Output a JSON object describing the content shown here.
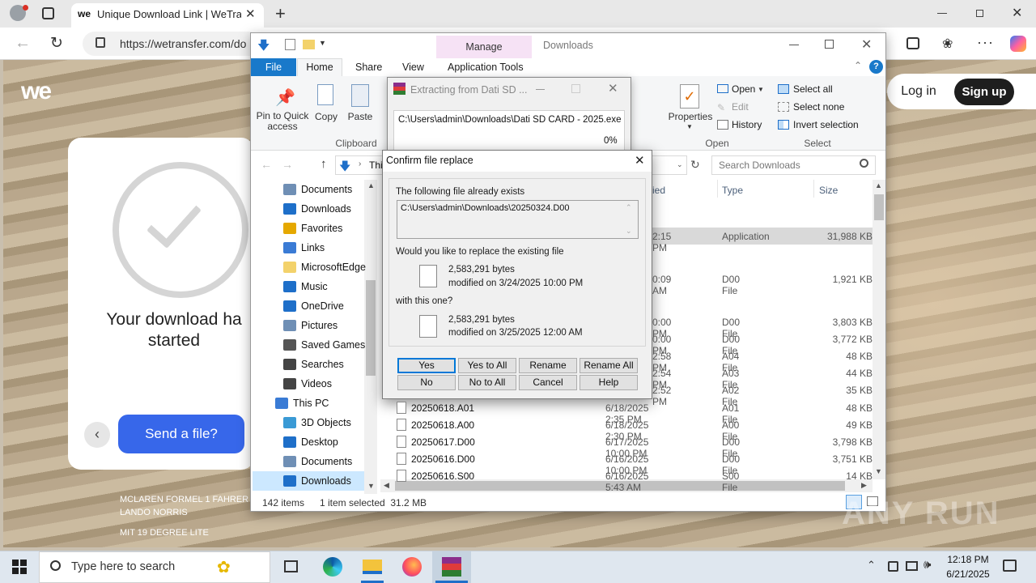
{
  "browser": {
    "tab_title": "Unique Download Link | WeTransf",
    "url": "https://wetransfer.com/do"
  },
  "wetransfer": {
    "logo": "we",
    "login": "Log in",
    "signup": "Sign up",
    "card_title": "Your download ha started",
    "send_button": "Send a file?",
    "caption_line1": "MCLAREN FORMEL 1 FAHRER",
    "caption_line2": "LANDO NORRIS",
    "caption_line3": "MIT 19 DEGREE LITE"
  },
  "explorer": {
    "manage_tab": "Manage",
    "window_title": "Downloads",
    "tabs": {
      "file": "File",
      "home": "Home",
      "share": "Share",
      "view": "View",
      "app_tools": "Application Tools"
    },
    "ribbon": {
      "pin": "Pin to Quick access",
      "copy": "Copy",
      "paste": "Paste",
      "clipboard": "Clipboard",
      "properties": "Properties",
      "open": "Open",
      "edit": "Edit",
      "history": "History",
      "open_group": "Open",
      "select_all": "Select all",
      "select_none": "Select none",
      "invert": "Invert selection",
      "select_group": "Select"
    },
    "path_partial": "Thi",
    "search_placeholder": "Search Downloads",
    "columns": {
      "date": "ied",
      "type": "Type",
      "size": "Size"
    },
    "nav_items": [
      {
        "label": "Documents",
        "icon": "documents-icon"
      },
      {
        "label": "Downloads",
        "icon": "downloads-icon"
      },
      {
        "label": "Favorites",
        "icon": "star-icon"
      },
      {
        "label": "Links",
        "icon": "links-icon"
      },
      {
        "label": "MicrosoftEdge",
        "icon": "folder-icon"
      },
      {
        "label": "Music",
        "icon": "music-icon"
      },
      {
        "label": "OneDrive",
        "icon": "cloud-icon"
      },
      {
        "label": "Pictures",
        "icon": "pictures-icon"
      },
      {
        "label": "Saved Games",
        "icon": "games-icon"
      },
      {
        "label": "Searches",
        "icon": "search-icon"
      },
      {
        "label": "Videos",
        "icon": "videos-icon"
      },
      {
        "label": "This PC",
        "icon": "pc-icon"
      },
      {
        "label": "3D Objects",
        "icon": "cube-icon"
      },
      {
        "label": "Desktop",
        "icon": "desktop-icon"
      },
      {
        "label": "Documents",
        "icon": "documents-icon"
      },
      {
        "label": "Downloads",
        "icon": "downloads-icon"
      }
    ],
    "partial_rows": [
      {
        "date": "2:15 PM",
        "type": "Application",
        "size": "31,988 KB"
      },
      {
        "date": "0:09 AM",
        "type": "D00 File",
        "size": "1,921 KB"
      },
      {
        "date": "0:00 PM",
        "type": "D00 File",
        "size": "3,803 KB"
      },
      {
        "date": "0:00 PM",
        "type": "D00 File",
        "size": "3,772 KB"
      },
      {
        "date": "2:58 PM",
        "type": "A04 File",
        "size": "48 KB"
      },
      {
        "date": "2:54 PM",
        "type": "A03 File",
        "size": "44 KB"
      },
      {
        "date": "2:52 PM",
        "type": "A02 File",
        "size": "35 KB"
      }
    ],
    "rows": [
      {
        "name": "20250618.A01",
        "date": "6/18/2025 2:35 PM",
        "type": "A01 File",
        "size": "48 KB"
      },
      {
        "name": "20250618.A00",
        "date": "6/18/2025 2:30 PM",
        "type": "A00 File",
        "size": "49 KB"
      },
      {
        "name": "20250617.D00",
        "date": "6/17/2025 10:00 PM",
        "type": "D00 File",
        "size": "3,798 KB"
      },
      {
        "name": "20250616.D00",
        "date": "6/16/2025 10:00 PM",
        "type": "D00 File",
        "size": "3,751 KB"
      },
      {
        "name": "20250616.S00",
        "date": "6/16/2025 5:43 AM",
        "type": "S00 File",
        "size": "14 KB"
      }
    ],
    "status": {
      "count": "142 items",
      "selected": "1 item selected  31.2 MB"
    }
  },
  "extract": {
    "title": "Extracting from Dati SD ...",
    "path": "C:\\Users\\admin\\Downloads\\Dati SD CARD - 2025.exe",
    "percent": "0%"
  },
  "confirm": {
    "title": "Confirm file replace",
    "exists_label": "The following file already exists",
    "file_path": "C:\\Users\\admin\\Downloads\\20250324.D00",
    "question": "Would you like to replace the existing file",
    "existing_size": "2,583,291 bytes",
    "existing_modified": "modified on 3/24/2025 10:00 PM",
    "with_label": "with this one?",
    "new_size": "2,583,291 bytes",
    "new_modified": "modified on 3/25/2025 12:00 AM",
    "buttons": {
      "yes": "Yes",
      "yes_all": "Yes to All",
      "rename": "Rename",
      "rename_all": "Rename All",
      "no": "No",
      "no_all": "No to All",
      "cancel": "Cancel",
      "help": "Help"
    }
  },
  "taskbar": {
    "search": "Type here to search",
    "time": "12:18 PM",
    "date": "6/21/2025"
  },
  "watermark": "ANY RUN",
  "colors": {
    "accent": "#0078d7",
    "wt_blue": "#3767ea",
    "selected_row": "#cce8ff"
  }
}
